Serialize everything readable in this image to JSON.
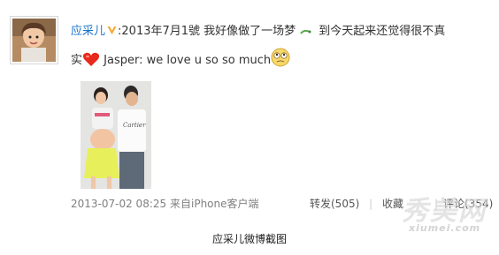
{
  "post": {
    "username": "应采儿",
    "text_part1": ":2013年7月1號 我好像做了一场梦",
    "text_part2": "到今天起来还觉得很不真",
    "text_part3": "实",
    "text_part4": "Jasper: we love u so so much",
    "timestamp": "2013-07-02 08:25",
    "source": "来自iPhone客户端"
  },
  "actions": {
    "repost": "转发(505)",
    "separator": "|",
    "favorite": "收藏",
    "comment": "评论(354)"
  },
  "caption": "应采儿微博截图",
  "watermark": {
    "cn": "秀美网",
    "en": "xiumei.com"
  },
  "colors": {
    "username": "#1874cd",
    "vip_badge": "#f7a52b",
    "meta": "#808080"
  },
  "icons": [
    "avatar",
    "vip-badge-icon",
    "tongue-emoji-icon",
    "heart-emoji-icon",
    "rolling-eyes-emoji-icon"
  ]
}
